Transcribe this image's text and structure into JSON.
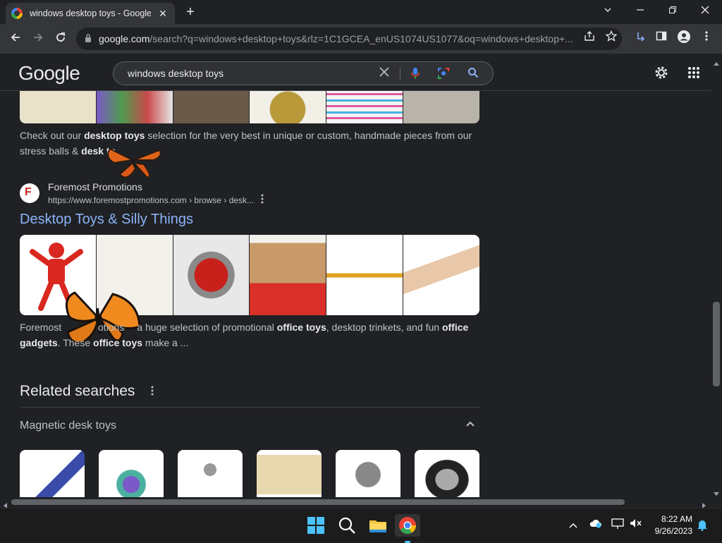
{
  "browser": {
    "tab_title": "windows desktop toys - Google S",
    "tab_close": "✕",
    "new_tab": "+",
    "url_domain": "google.com",
    "url_path": "/search?q=windows+desktop+toys&rlz=1C1GCEA_enUS1074US1077&oq=windows+desktop+..."
  },
  "google": {
    "logo": "Google",
    "query": "windows desktop toys"
  },
  "results": {
    "etsy_snippet_pre": "Check out our ",
    "etsy_snippet_bold": "desktop toys",
    "etsy_snippet_post": " selection for the very best in unique or custom, handmade pieces from our",
    "etsy_snippet_line2_pre": "stress balls & ",
    "etsy_snippet_line2_bold": "desk to",
    "site_name": "Foremost Promotions",
    "site_url": "https://www.foremostpromotions.com › browse › desk...",
    "result_title": "Desktop Toys & Silly Things",
    "snippet_a": "Foremost ",
    "snippet_b": "otions",
    "snippet_c": "a huge selection of promotional ",
    "snippet_bold1": "office toys",
    "snippet_d": ", desktop trinkets, and fun ",
    "snippet_bold2": "office",
    "snippet_line2_bold": "gadgets",
    "snippet_e": ". These ",
    "snippet_bold3": "office toys",
    "snippet_f": " make a ..."
  },
  "related": {
    "title": "Related searches",
    "group_label": "Magnetic desk toys"
  },
  "taskbar": {
    "time": "8:22 AM",
    "date": "9/26/2023"
  }
}
